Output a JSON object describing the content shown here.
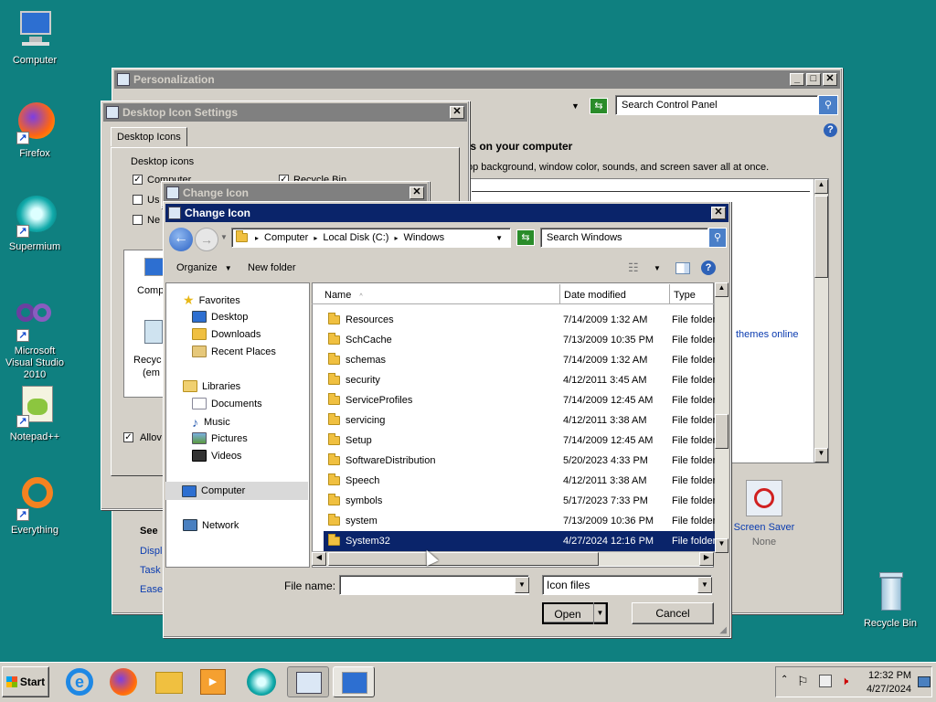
{
  "desktop_icons": [
    {
      "label": "Computer",
      "icon": "computer-icon"
    },
    {
      "label": "Firefox",
      "icon": "firefox-icon"
    },
    {
      "label": "Supermium",
      "icon": "supermium-icon"
    },
    {
      "label": "Microsoft Visual Studio 2010",
      "icon": "visual-studio-icon"
    },
    {
      "label": "Notepad++",
      "icon": "notepadpp-icon"
    },
    {
      "label": "Everything",
      "icon": "everything-icon"
    },
    {
      "label": "Recycle Bin",
      "icon": "recycle-bin-icon"
    }
  ],
  "personalization": {
    "title": "Personalization",
    "search_placeholder": "Search Control Panel",
    "heading": "ls on your computer",
    "subtext": "op background, window color, sounds, and screen saver all at once.",
    "themes_link": "themes online",
    "see_also": "See",
    "links": [
      "Displ",
      "Task",
      "Ease"
    ],
    "screen_saver_label": "Screen Saver",
    "screen_saver_value": "None"
  },
  "desktop_icon_settings": {
    "title": "Desktop Icon Settings",
    "tab": "Desktop Icons",
    "group": "Desktop icons",
    "checks": [
      {
        "label": "Computer",
        "checked": true
      },
      {
        "label": "Us",
        "checked": false
      },
      {
        "label": "Ne",
        "checked": false
      },
      {
        "label": "Recycle Bin",
        "checked": true
      }
    ],
    "preview_labels": [
      "Comp",
      "Recyc",
      "(em"
    ],
    "allow_label": "Allov"
  },
  "change_icon_small": {
    "title": "Change Icon"
  },
  "change_icon": {
    "title": "Change Icon",
    "breadcrumb": [
      "Computer",
      "Local Disk (C:)",
      "Windows"
    ],
    "search_placeholder": "Search Windows",
    "organize": "Organize",
    "new_folder": "New folder",
    "columns": [
      "Name",
      "Date modified",
      "Type"
    ],
    "nav": {
      "favorites": "Favorites",
      "fav_items": [
        "Desktop",
        "Downloads",
        "Recent Places"
      ],
      "libraries": "Libraries",
      "lib_items": [
        "Documents",
        "Music",
        "Pictures",
        "Videos"
      ],
      "computer": "Computer",
      "network": "Network"
    },
    "rows": [
      {
        "name": "Resources",
        "date": "7/14/2009 1:32 AM",
        "type": "File folder"
      },
      {
        "name": "SchCache",
        "date": "7/13/2009 10:35 PM",
        "type": "File folder"
      },
      {
        "name": "schemas",
        "date": "7/14/2009 1:32 AM",
        "type": "File folder"
      },
      {
        "name": "security",
        "date": "4/12/2011 3:45 AM",
        "type": "File folder"
      },
      {
        "name": "ServiceProfiles",
        "date": "7/14/2009 12:45 AM",
        "type": "File folder"
      },
      {
        "name": "servicing",
        "date": "4/12/2011 3:38 AM",
        "type": "File folder"
      },
      {
        "name": "Setup",
        "date": "7/14/2009 12:45 AM",
        "type": "File folder"
      },
      {
        "name": "SoftwareDistribution",
        "date": "5/20/2023 4:33 PM",
        "type": "File folder"
      },
      {
        "name": "Speech",
        "date": "4/12/2011 3:38 AM",
        "type": "File folder"
      },
      {
        "name": "symbols",
        "date": "5/17/2023 7:33 PM",
        "type": "File folder"
      },
      {
        "name": "system",
        "date": "7/13/2009 10:36 PM",
        "type": "File folder"
      },
      {
        "name": "System32",
        "date": "4/27/2024 12:16 PM",
        "type": "File folder",
        "selected": true
      }
    ],
    "filename_label": "File name:",
    "filename_value": "",
    "filter_value": "Icon files",
    "open_label": "Open",
    "cancel_label": "Cancel"
  },
  "taskbar": {
    "start_label": "Start",
    "time": "12:32 PM",
    "date": "4/27/2024"
  }
}
